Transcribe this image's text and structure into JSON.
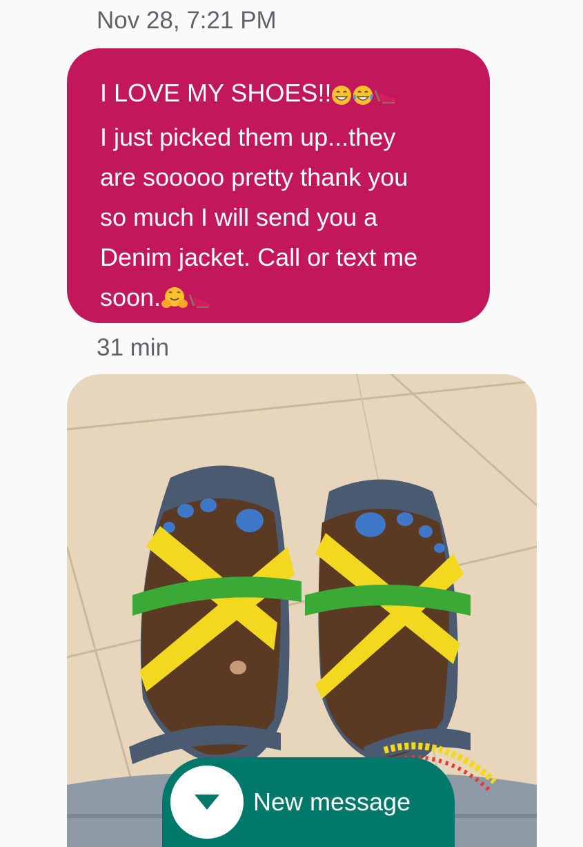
{
  "conversation": {
    "timestamp_1": "Nov 28, 7:21 PM",
    "message": {
      "line_1": "I LOVE MY SHOES!!",
      "line_2": "I just picked them up...they",
      "line_3": "are sooooo pretty thank you",
      "line_4": "so much I will send you a",
      "line_5": "Denim jacket. Call or text me",
      "line_6": "soon.",
      "line_1_emojis": [
        "grinning-face-icon",
        "tears-of-joy-icon",
        "high-heel-shoe-icon"
      ],
      "line_6_emojis": [
        "hugging-face-icon",
        "high-heel-shoe-icon"
      ]
    },
    "timestamp_2": "31 min"
  },
  "new_message_button": {
    "label": "New message",
    "icon": "chevron-down-icon"
  },
  "colors": {
    "bubble": "#c2185b",
    "new_message": "#00796b",
    "timestamp": "#5f6368",
    "background": "#fafafa"
  }
}
